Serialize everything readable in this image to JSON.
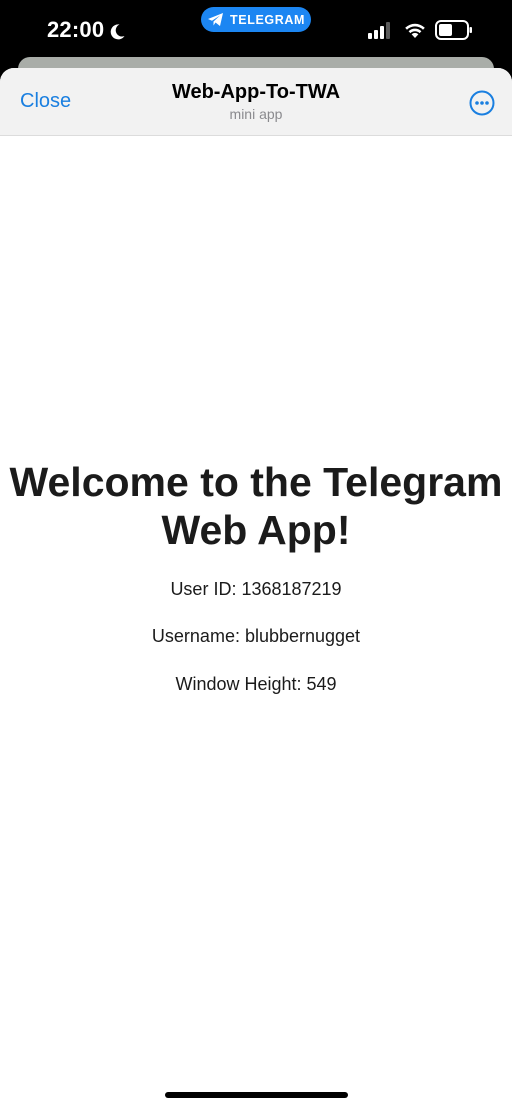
{
  "status_bar": {
    "time": "22:00",
    "moon_icon": "moon-icon",
    "app_pill_label": "TELEGRAM",
    "app_pill_icon": "paper-plane-icon",
    "app_pill_color": "#1c86f2",
    "signal_icon": "cellular-signal-icon",
    "wifi_icon": "wifi-icon",
    "battery_icon": "battery-icon"
  },
  "nav": {
    "close_label": "Close",
    "title": "Web-App-To-TWA",
    "subtitle": "mini app",
    "more_icon": "more-horizontal-icon",
    "accent_color": "#1a7fe0"
  },
  "main": {
    "welcome_title": "Welcome to the Telegram Web App!",
    "user_id_line": "User ID: 1368187219",
    "username_line": "Username: blubbernugget",
    "window_height_line": "Window Height: 549"
  }
}
